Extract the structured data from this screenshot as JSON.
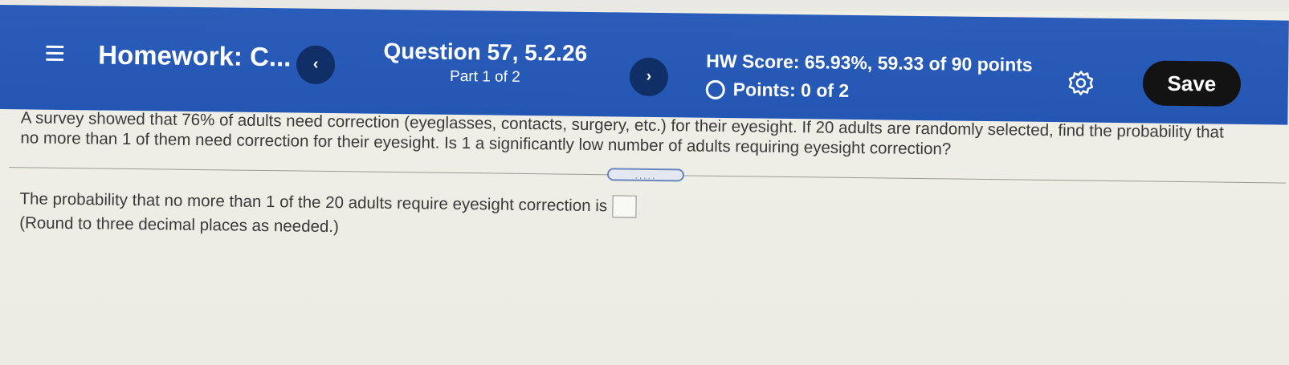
{
  "header": {
    "homework_title": "Homework: C...",
    "prev_label": "‹",
    "next_label": "›",
    "question_title": "Question 57, 5.2.26",
    "question_part": "Part 1 of 2",
    "hw_score": "HW Score: 65.93%, 59.33 of 90 points",
    "points": "Points: 0 of 2",
    "save_label": "Save",
    "icons": [
      "menu-icon",
      "chevron-left-icon",
      "chevron-right-icon",
      "circle-icon",
      "gear-icon"
    ]
  },
  "problem": {
    "text": "A survey showed that 76% of adults need correction (eyeglasses, contacts, surgery, etc.) for their eyesight. If 20 adults are randomly selected, find the probability that no more than 1 of them need correction for their eyesight. Is 1 a significantly low number of adults requiring eyesight correction?",
    "expand_label": "....."
  },
  "answer": {
    "prompt": "The probability that no more than 1 of the 20 adults require eyesight correction is",
    "value": "",
    "note": "(Round to three decimal places as needed.)"
  },
  "colors": {
    "header_blue": "#2a5cb9",
    "nav_button": "#0f2f66",
    "save_button": "#131313",
    "background": "#eeeee6"
  }
}
